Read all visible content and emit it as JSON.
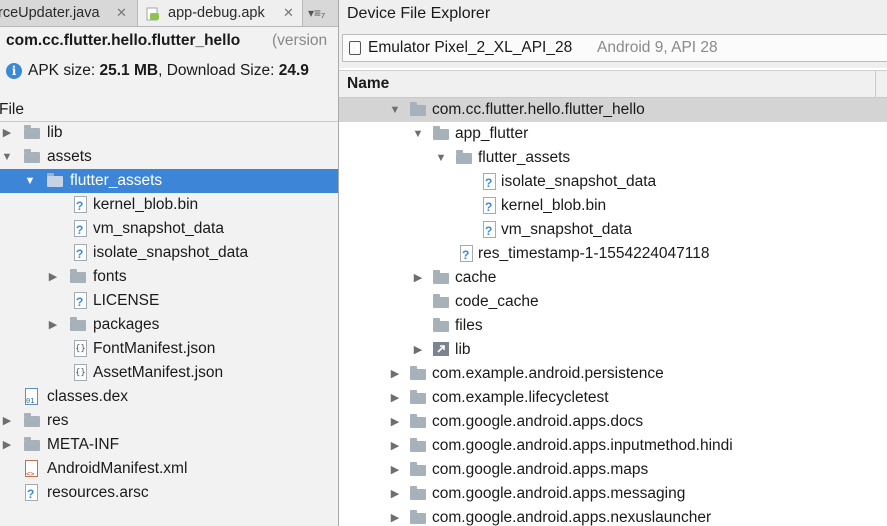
{
  "tabs": [
    {
      "label": "rceUpdater.java",
      "close": "✕"
    },
    {
      "label": "app-debug.apk",
      "close": "✕"
    },
    {
      "label": "▾≡₇"
    }
  ],
  "apk": {
    "package": "com.cc.flutter.hello.flutter_hello",
    "version_suffix": "(version",
    "size_text": "APK size: ",
    "size_value": "25.1 MB",
    "download_text": ", Download Size: ",
    "download_value": "24.9"
  },
  "left_tree": {
    "header": "File",
    "items": [
      {
        "label": "lib",
        "icon": "folder-icon",
        "arrow": "▶"
      },
      {
        "label": "assets",
        "icon": "folder-icon",
        "arrow": "▼"
      },
      {
        "label": "flutter_assets",
        "icon": "folder-icon",
        "arrow": "▼",
        "selected": true
      },
      {
        "label": "kernel_blob.bin",
        "icon": "unknown-file-icon"
      },
      {
        "label": "vm_snapshot_data",
        "icon": "unknown-file-icon"
      },
      {
        "label": "isolate_snapshot_data",
        "icon": "unknown-file-icon"
      },
      {
        "label": "fonts",
        "icon": "folder-icon",
        "arrow": "▶"
      },
      {
        "label": "LICENSE",
        "icon": "unknown-file-icon"
      },
      {
        "label": "packages",
        "icon": "folder-icon",
        "arrow": "▶"
      },
      {
        "label": "FontManifest.json",
        "icon": "json-file-icon"
      },
      {
        "label": "AssetManifest.json",
        "icon": "json-file-icon"
      },
      {
        "label": "classes.dex",
        "icon": "dex-file-icon"
      },
      {
        "label": "res",
        "icon": "folder-icon",
        "arrow": "▶"
      },
      {
        "label": "META-INF",
        "icon": "folder-icon",
        "arrow": "▶"
      },
      {
        "label": "AndroidManifest.xml",
        "icon": "xml-file-icon"
      },
      {
        "label": "resources.arsc",
        "icon": "unknown-file-icon"
      }
    ]
  },
  "device_explorer": {
    "title": "Device File Explorer",
    "device_name": "Emulator Pixel_2_XL_API_28",
    "device_info": "Android 9, API 28",
    "column_name": "Name",
    "items": [
      {
        "label": "com.cc.flutter.hello.flutter_hello",
        "icon": "folder-icon",
        "arrow": "▼",
        "selected": true
      },
      {
        "label": "app_flutter",
        "icon": "folder-icon",
        "arrow": "▼"
      },
      {
        "label": "flutter_assets",
        "icon": "folder-icon",
        "arrow": "▼"
      },
      {
        "label": "isolate_snapshot_data",
        "icon": "unknown-file-icon"
      },
      {
        "label": "kernel_blob.bin",
        "icon": "unknown-file-icon"
      },
      {
        "label": "vm_snapshot_data",
        "icon": "unknown-file-icon"
      },
      {
        "label": "res_timestamp-1-1554224047118",
        "icon": "unknown-file-icon"
      },
      {
        "label": "cache",
        "icon": "folder-icon",
        "arrow": "▶"
      },
      {
        "label": "code_cache",
        "icon": "folder-icon"
      },
      {
        "label": "files",
        "icon": "folder-icon"
      },
      {
        "label": "lib",
        "icon": "symlink-folder-icon",
        "arrow": "▶"
      },
      {
        "label": "com.example.android.persistence",
        "icon": "folder-icon",
        "arrow": "▶"
      },
      {
        "label": "com.example.lifecycletest",
        "icon": "folder-icon",
        "arrow": "▶"
      },
      {
        "label": "com.google.android.apps.docs",
        "icon": "folder-icon",
        "arrow": "▶"
      },
      {
        "label": "com.google.android.apps.inputmethod.hindi",
        "icon": "folder-icon",
        "arrow": "▶"
      },
      {
        "label": "com.google.android.apps.maps",
        "icon": "folder-icon",
        "arrow": "▶"
      },
      {
        "label": "com.google.android.apps.messaging",
        "icon": "folder-icon",
        "arrow": "▶"
      },
      {
        "label": "com.google.android.apps.nexuslauncher",
        "icon": "folder-icon",
        "arrow": "▶"
      }
    ]
  },
  "colors": {
    "selection": "#3d86d7",
    "info": "#3a8ad8",
    "folder": "#a7b1ba"
  }
}
